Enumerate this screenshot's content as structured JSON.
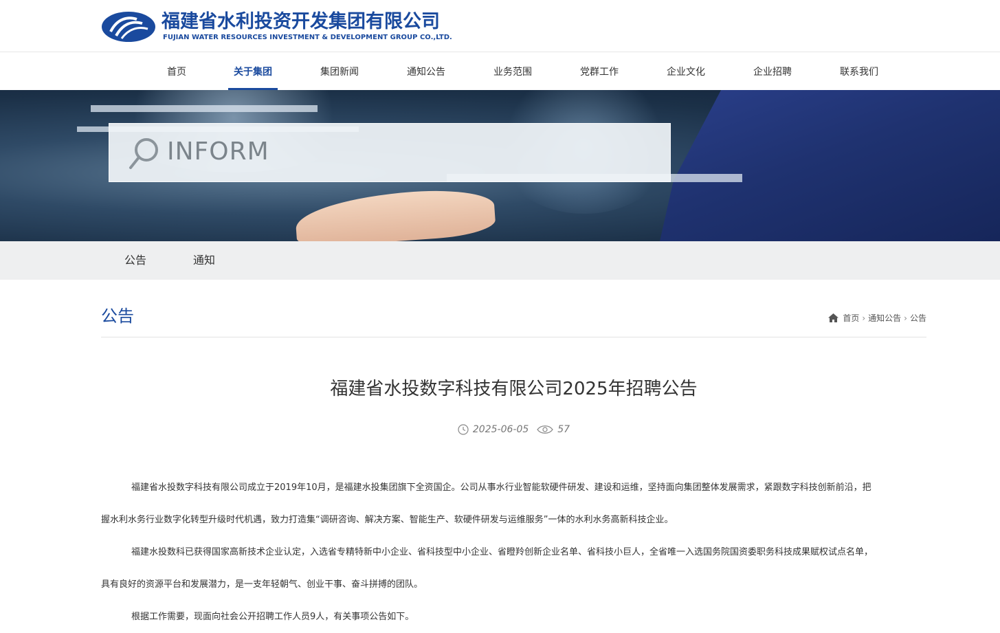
{
  "logo": {
    "name_cn": "福建省水利投资开发集团有限公司",
    "name_en": "FUJIAN WATER RESOURCES INVESTMENT & DEVELOPMENT GROUP CO.,LTD."
  },
  "nav": {
    "items": [
      {
        "label": "首页"
      },
      {
        "label": "关于集团",
        "active": true
      },
      {
        "label": "集团新闻"
      },
      {
        "label": "通知公告"
      },
      {
        "label": "业务范围"
      },
      {
        "label": "党群工作"
      },
      {
        "label": "企业文化"
      },
      {
        "label": "企业招聘"
      },
      {
        "label": "联系我们"
      }
    ]
  },
  "banner": {
    "search_text": "INFORM",
    "search_icon": "magnifier-icon"
  },
  "subnav": {
    "items": [
      {
        "label": "公告"
      },
      {
        "label": "通知"
      }
    ]
  },
  "section": {
    "title": "公告"
  },
  "breadcrumb": {
    "home_icon": "home-icon",
    "items": [
      "首页",
      "通知公告",
      "公告"
    ]
  },
  "article": {
    "title": "福建省水投数字科技有限公司2025年招聘公告",
    "date": "2025-06-05",
    "views": "57",
    "paragraph_lines": [
      "福建省水投数字科技有限公司成立于2019年10月，是福建水投集团旗下全资国企。公司从事水行业智能软硬件研发、建设和运维，坚持面向集团整体发展需求，紧跟数字科技创新前沿，把",
      "握水利水务行业数字化转型升级时代机遇，致力打造集“调研咨询、解决方案、智能生产、软硬件研发与运维服务”一体的水利水务高新科技企业。",
      "福建水投数科已获得国家高新技术企业认定，入选省专精特新中小企业、省科技型中小企业、省瞪羚创新企业名单、省科技小巨人，全省唯一入选国务院国资委职务科技成果赋权试点名单，",
      "具有良好的资源平台和发展潜力，是一支年轻朝气、创业干事、奋斗拼搏的团队。",
      "根据工作需要，现面向社会公开招聘工作人员9人，有关事项公告如下。"
    ]
  },
  "colors": {
    "brand_blue": "#1a4a9e",
    "subnav_bg": "#eeeff0"
  }
}
